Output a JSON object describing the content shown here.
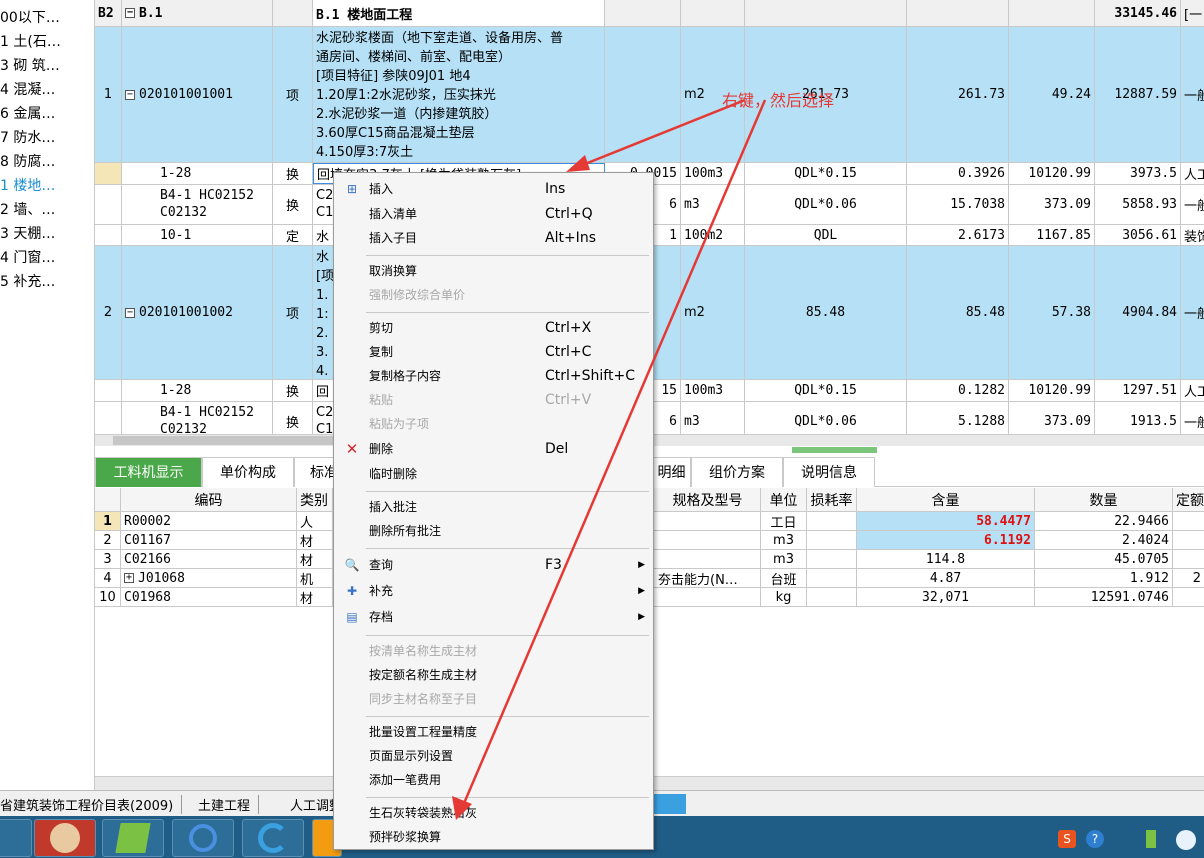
{
  "left_tree": {
    "items": [
      {
        "label": "00以下…"
      },
      {
        "label": "1 土(石…"
      },
      {
        "label": "3 砌 筑…"
      },
      {
        "label": "4 混凝…"
      },
      {
        "label": "6 金属…"
      },
      {
        "label": "7 防水…"
      },
      {
        "label": "8 防腐…"
      },
      {
        "label": "1 楼地…"
      },
      {
        "label": "2 墙、…"
      },
      {
        "label": "3 天棚…"
      },
      {
        "label": "4 门窗…"
      },
      {
        "label": "5 补充…"
      }
    ]
  },
  "grid": {
    "section": {
      "code": "B2",
      "id": "B.1",
      "name": "B.1   楼地面工程",
      "total": "33145.46",
      "tail": "[一"
    },
    "item1": {
      "seq": "1",
      "code": "020101001001",
      "type": "项",
      "desc_lines": [
        "水泥砂浆楼面（地下室走道、设备用房、普",
        "通房间、楼梯间、前室、配电室）",
        "[项目特征]   参陕09J01 地4",
        "1.20厚1:2水泥砂浆，压实抹光",
        "2.水泥砂浆一道（内掺建筑胶）",
        "3.60厚C15商品混凝土垫层",
        "4.150厚3:7灰土"
      ],
      "unit": "m2",
      "qty_expr": "261.73",
      "qty": "261.73",
      "price": "49.24",
      "total": "12887.59",
      "tail": "一般"
    },
    "sub1": {
      "code": "1-28",
      "type": "换",
      "desc": "回填夯实3:7灰土 [换为袋装熟石灰]",
      "coef": "0.0015",
      "unit": "100m3",
      "qty_expr": "QDL*0.15",
      "qty": "0.3926",
      "price": "10120.99",
      "total": "3973.5",
      "tail": "人工"
    },
    "sub2": {
      "code_lines": [
        "B4-1 HC02152",
        "C02132"
      ],
      "type": "换",
      "desc_lines": [
        "C2",
        "C1"
      ],
      "coef": "6",
      "unit": "m3",
      "qty_expr": "QDL*0.06",
      "qty": "15.7038",
      "price": "373.09",
      "total": "5858.93",
      "tail": "一般"
    },
    "sub3": {
      "code": "10-1",
      "type": "定",
      "desc": "水",
      "coef": "1",
      "unit": "100m2",
      "qty_expr": "QDL",
      "qty": "2.6173",
      "price": "1167.85",
      "total": "3056.61",
      "tail": "装饰"
    },
    "item2": {
      "seq": "2",
      "code": "020101001002",
      "type": "项",
      "desc_lines": [
        "水",
        "[项",
        "1.",
        "1:",
        "2.",
        "3.",
        "4."
      ],
      "unit": "m2",
      "qty_expr": "85.48",
      "qty": "85.48",
      "price": "57.38",
      "total": "4904.84",
      "tail": "一般"
    },
    "sub4": {
      "code": "1-28",
      "type": "换",
      "desc": "回",
      "coef": "15",
      "unit": "100m3",
      "qty_expr": "QDL*0.15",
      "qty": "0.1282",
      "price": "10120.99",
      "total": "1297.51",
      "tail": "人工"
    },
    "sub5": {
      "code_lines": [
        "B4-1 HC02152",
        "C02132"
      ],
      "type": "换",
      "desc_lines": [
        "C2",
        "C1"
      ],
      "coef": "6",
      "unit": "m3",
      "qty_expr": "QDL*0.06",
      "qty": "5.1288",
      "price": "373.09",
      "total": "1913.5",
      "tail": "一般"
    }
  },
  "tabs": [
    {
      "label": "工料机显示"
    },
    {
      "label": "单价构成"
    },
    {
      "label": "标准"
    },
    {
      "label": "明细"
    },
    {
      "label": "组价方案"
    },
    {
      "label": "说明信息"
    }
  ],
  "lower_table": {
    "headers": {
      "code": "编码",
      "type": "类别",
      "spec": "规格及型号",
      "unit": "单位",
      "loss": "损耗率",
      "content": "含量",
      "qty": "数量",
      "fixed": "定额"
    },
    "rows": [
      {
        "seq": "1",
        "code": "R00002",
        "type": "人",
        "spec": "",
        "unit": "工日",
        "content": "58.4477",
        "qty": "22.9466",
        "fixed": ""
      },
      {
        "seq": "2",
        "code": "C01167",
        "type": "材",
        "spec": "",
        "unit": "m3",
        "content": "6.1192",
        "qty": "2.4024",
        "fixed": ""
      },
      {
        "seq": "3",
        "code": "C02166",
        "type": "材",
        "spec": "",
        "unit": "m3",
        "content": "114.8",
        "qty": "45.0705",
        "fixed": ""
      },
      {
        "seq": "4",
        "code": "J01068",
        "type": "机",
        "spec": "夯击能力(N…",
        "unit": "台班",
        "content": "4.87",
        "qty": "1.912",
        "fixed": "2"
      },
      {
        "seq": "10",
        "code": "C01968",
        "type": "材",
        "spec": "",
        "unit": "kg",
        "content": "32,071",
        "qty": "12591.0746",
        "fixed": ""
      }
    ]
  },
  "context_menu": {
    "items": [
      {
        "label": "插入",
        "shortcut": "Ins"
      },
      {
        "label": "插入清单",
        "shortcut": "Ctrl+Q"
      },
      {
        "label": "插入子目",
        "shortcut": "Alt+Ins"
      },
      {
        "label": "取消换算",
        "shortcut": ""
      },
      {
        "label": "强制修改综合单价",
        "shortcut": ""
      },
      {
        "label": "剪切",
        "shortcut": "Ctrl+X"
      },
      {
        "label": "复制",
        "shortcut": "Ctrl+C"
      },
      {
        "label": "复制格子内容",
        "shortcut": "Ctrl+Shift+C"
      },
      {
        "label": "粘贴",
        "shortcut": "Ctrl+V"
      },
      {
        "label": "粘贴为子项",
        "shortcut": ""
      },
      {
        "label": "删除",
        "shortcut": "Del"
      },
      {
        "label": "临时删除",
        "shortcut": ""
      },
      {
        "label": "插入批注",
        "shortcut": ""
      },
      {
        "label": "删除所有批注",
        "shortcut": ""
      },
      {
        "label": "查询",
        "shortcut": "F3"
      },
      {
        "label": "补充",
        "shortcut": ""
      },
      {
        "label": "存档",
        "shortcut": ""
      },
      {
        "label": "按清单名称生成主材",
        "shortcut": ""
      },
      {
        "label": "按定额名称生成主材",
        "shortcut": ""
      },
      {
        "label": "同步主材名称至子目",
        "shortcut": ""
      },
      {
        "label": "批量设置工程量精度",
        "shortcut": ""
      },
      {
        "label": "页面显示列设置",
        "shortcut": ""
      },
      {
        "label": "添加一笔费用",
        "shortcut": ""
      },
      {
        "label": "生石灰转袋装熟石灰",
        "shortcut": ""
      },
      {
        "label": "预拌砂浆换算",
        "shortcut": ""
      }
    ]
  },
  "statusbar": {
    "items": [
      {
        "label": "省建筑装饰工程价目表(2009)"
      },
      {
        "label": "土建工程"
      },
      {
        "label": "人工调整"
      }
    ]
  },
  "annotation": {
    "text": "右键，然后选择",
    "color": "#e53935"
  },
  "colors": {
    "row_highlight": "#b5e0f5",
    "tab_active": "#4aa84a",
    "content_red": "#e01010",
    "taskbar": "#1f5d86"
  }
}
